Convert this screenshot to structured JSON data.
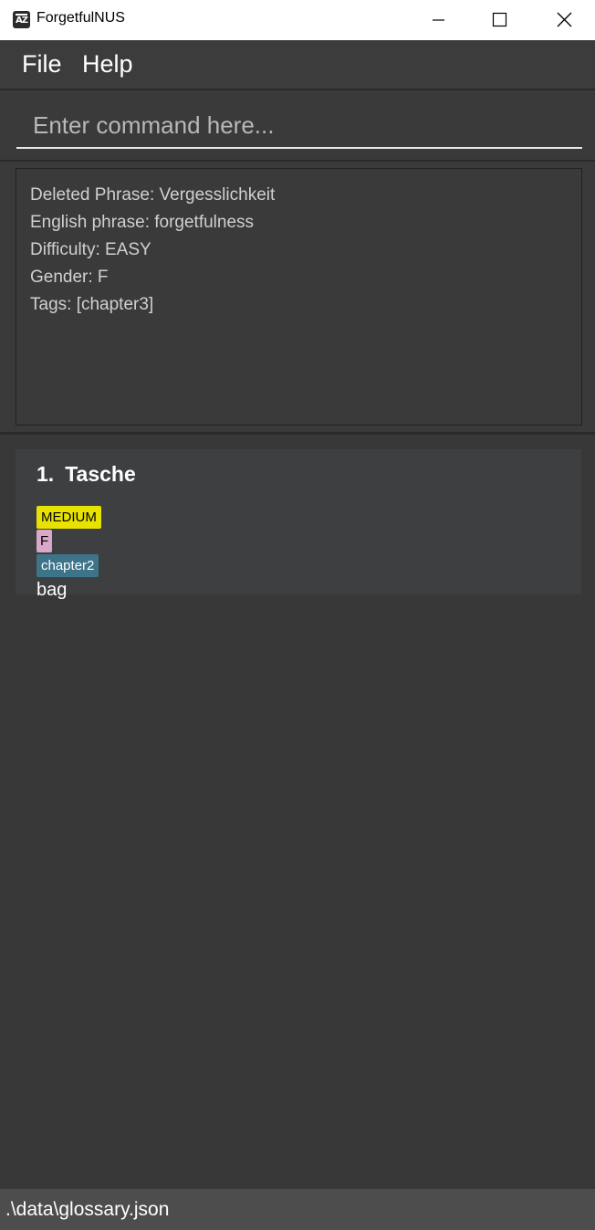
{
  "window": {
    "title": "ForgetfulNUS",
    "icon_text": "AZ"
  },
  "menu": {
    "items": [
      {
        "label": "File"
      },
      {
        "label": "Help"
      }
    ]
  },
  "command": {
    "value": "",
    "placeholder": "Enter command here..."
  },
  "result": {
    "lines": [
      "Deleted Phrase: Vergesslichkeit",
      "English phrase: forgetfulness",
      "Difficulty: EASY",
      "Gender: F",
      "Tags: [chapter3]"
    ]
  },
  "phrases": [
    {
      "index": "1.",
      "phrase": "Tasche",
      "difficulty": "MEDIUM",
      "gender": "F",
      "tags": [
        "chapter2"
      ],
      "meaning": "bag"
    }
  ],
  "status": {
    "path": ".\\data\\glossary.json"
  },
  "colors": {
    "background": "#383838",
    "difficulty_medium": "#e8e200",
    "gender_f": "#d8a7c9",
    "tag": "#3d7489"
  }
}
